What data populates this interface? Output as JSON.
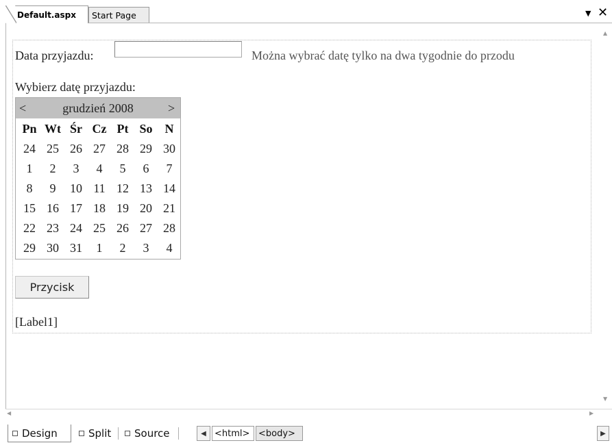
{
  "tabs": {
    "active_label": "Default.aspx",
    "inactive_label": "Start Page",
    "dropdown_icon": "▼",
    "close_icon": "✕"
  },
  "form": {
    "arrival_label": "Data przyjazdu:",
    "arrival_input_value": "",
    "hint": "Można wybrać datę tylko na dwa tygodnie do przodu",
    "choose_label": "Wybierz datę przyjazdu:",
    "button_label": "Przycisk",
    "label1_text": "[Label1]"
  },
  "calendar": {
    "prev": "<",
    "next": ">",
    "title": "grudzień 2008",
    "day_headers": [
      "Pn",
      "Wt",
      "Śr",
      "Cz",
      "Pt",
      "So",
      "N"
    ],
    "weeks": [
      [
        "24",
        "25",
        "26",
        "27",
        "28",
        "29",
        "30"
      ],
      [
        "1",
        "2",
        "3",
        "4",
        "5",
        "6",
        "7"
      ],
      [
        "8",
        "9",
        "10",
        "11",
        "12",
        "13",
        "14"
      ],
      [
        "15",
        "16",
        "17",
        "18",
        "19",
        "20",
        "21"
      ],
      [
        "22",
        "23",
        "24",
        "25",
        "26",
        "27",
        "28"
      ],
      [
        "29",
        "30",
        "31",
        "1",
        "2",
        "3",
        "4"
      ]
    ],
    "header_bg": "#c0c0c0"
  },
  "viewbar": {
    "design": "Design",
    "split": "Split",
    "source": "Source",
    "crumbs": [
      "<html>",
      "<body>"
    ],
    "prev_icon": "◀",
    "next_icon": "▶"
  },
  "scroll": {
    "up": "▲",
    "down": "▼",
    "left": "◀",
    "right": "▶"
  }
}
